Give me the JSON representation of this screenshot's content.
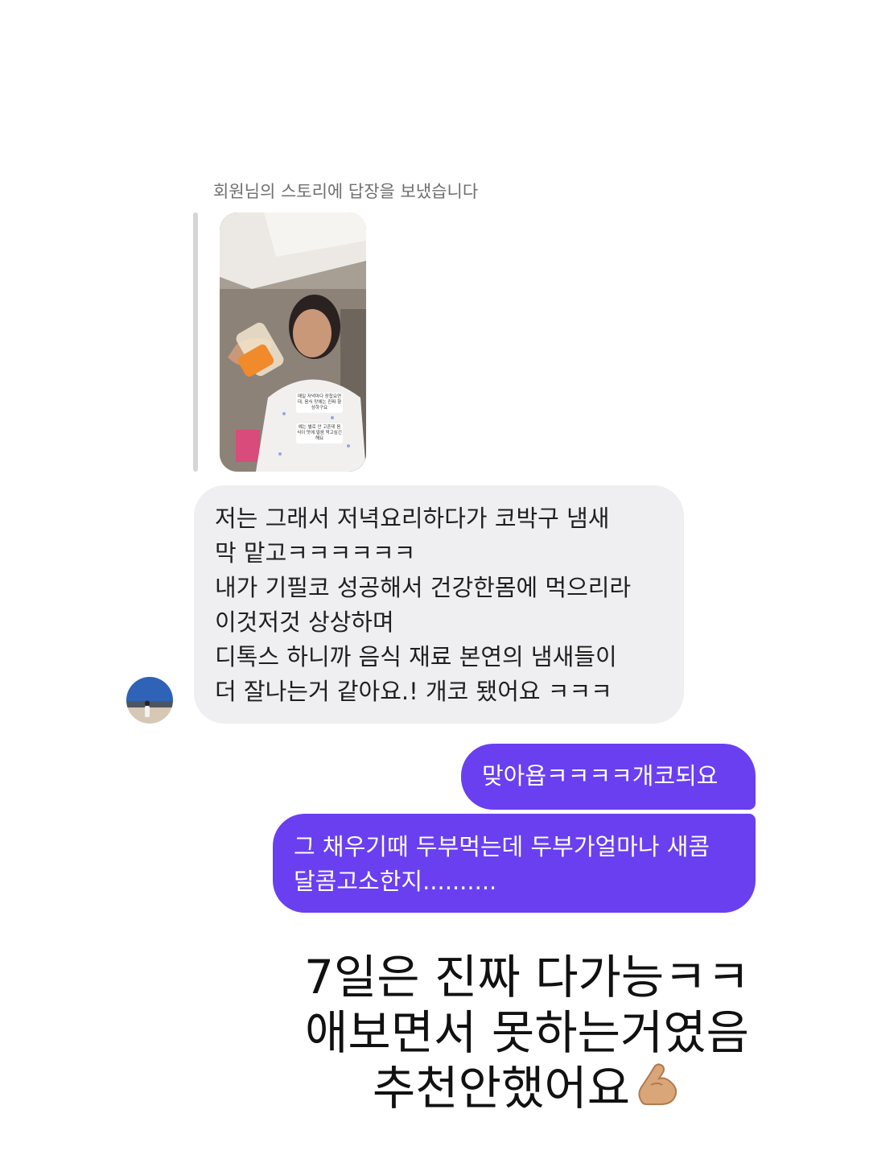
{
  "story_reply": {
    "notice": "회원님의 스토리에 답장을 보냈습니다",
    "story_captions": [
      "매일 저녁마다 장찹요연대, 음식 맛에는 진짜 향상하구요",
      "예는 별로 안 고픈데 음식이 맛에 얼음 먹고싶긴해요"
    ]
  },
  "incoming": {
    "avatar": "profile-avatar",
    "lines": [
      "저는 그래서 저녁요리하다가 코박구 냄새",
      "막 맡고ㅋㅋㅋㅋㅋㅋ",
      "내가 기필코 성공해서 건강한몸에 먹으리라",
      "이것저것 상상하며",
      "디톡스 하니까 음식 재료 본연의 냄새들이",
      "더 잘나는거 같아요.! 개코 됐어요 ㅋㅋㅋ"
    ]
  },
  "outgoing": [
    {
      "lines": [
        "맞아욥ㅋㅋㅋㅋ개코되요"
      ]
    },
    {
      "lines": [
        "그 채우기때 두부먹는데 두부가얼마나 새콤",
        "달콤고소한지.........."
      ]
    }
  ],
  "overlay_text": {
    "lines": [
      "7일은 진짜 다가능ㅋㅋ",
      "애보면서 못하는거였음",
      "추천안했어요"
    ],
    "emoji": "flexed-biceps-emoji"
  },
  "colors": {
    "outgoing_bubble": "#6a3ff0",
    "incoming_bubble": "#efeff2",
    "notice_text": "#6f6f6f"
  }
}
